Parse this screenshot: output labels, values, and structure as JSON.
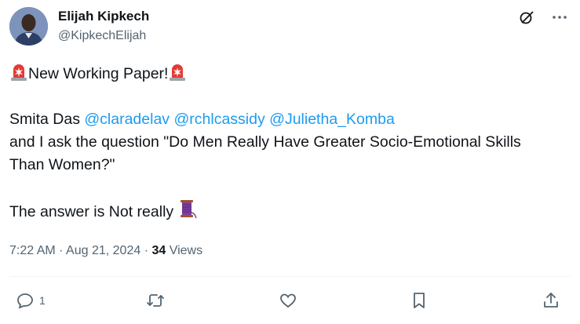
{
  "author": {
    "name": "Elijah Kipkech",
    "handle": "@KipkechElijah"
  },
  "icons": {
    "grok": "grok-icon",
    "more": "more-icon",
    "siren": "police-light-emoji",
    "thread": "spool-of-thread-emoji"
  },
  "post": {
    "line1": "New Working Paper!",
    "line3_prefix": "Smita Das",
    "mentions": [
      "@claradelav",
      "@rchlcassidy",
      "@Julietha_Komba"
    ],
    "line4": "and I ask the question \"Do Men Really Have Greater Socio-Emotional Skills",
    "line5": "Than Women?\"",
    "line7": "The answer is Not really"
  },
  "meta": {
    "time": "7:22 AM",
    "sep1": " · ",
    "date": "Aug 21, 2024",
    "sep2": " · ",
    "views_count": "34",
    "views_label": " Views"
  },
  "actions": {
    "reply_count": "1"
  },
  "colors": {
    "accent": "#1d9bf0",
    "text": "#0f1419",
    "secondary": "#536471",
    "siren": "#e53935",
    "thread": "#7b3fa1"
  }
}
